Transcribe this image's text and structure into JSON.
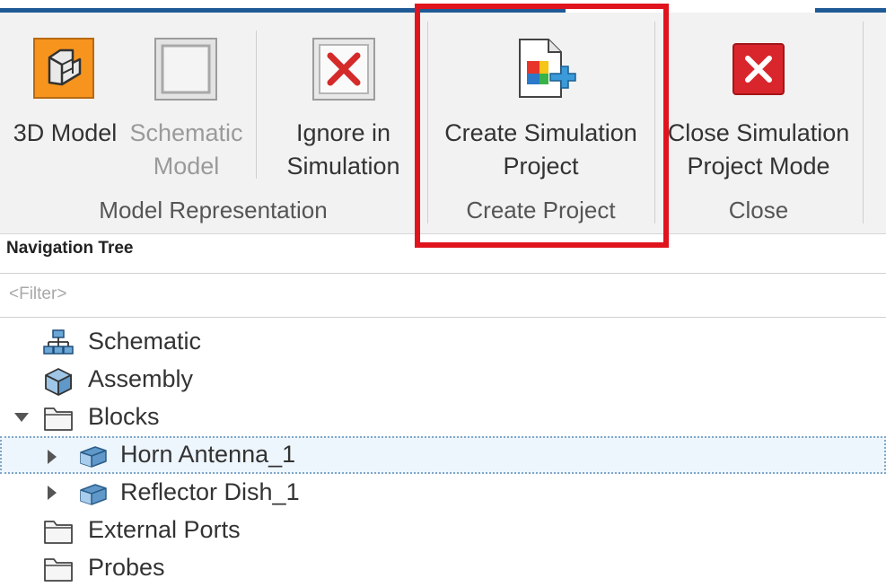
{
  "ribbon": {
    "buttons": {
      "model_3d": "3D Model",
      "schematic_line1": "Schematic",
      "schematic_line2": "Model",
      "ignore_line1": "Ignore in",
      "ignore_line2": "Simulation",
      "create_line1": "Create Simulation",
      "create_line2": "Project",
      "close_line1": "Close Simulation",
      "close_line2": "Project Mode"
    },
    "groups": {
      "model_representation": "Model Representation",
      "create_project": "Create Project",
      "close": "Close"
    }
  },
  "navigation_tree": {
    "title": "Navigation Tree",
    "filter_placeholder": "<Filter>",
    "items": [
      {
        "label": "Schematic",
        "icon": "schematic-icon"
      },
      {
        "label": "Assembly",
        "icon": "assembly-icon"
      },
      {
        "label": "Blocks",
        "icon": "folder-icon",
        "expanded": true
      },
      {
        "label": "Horn Antenna_1",
        "icon": "block-icon",
        "selected": true
      },
      {
        "label": "Reflector Dish_1",
        "icon": "block-icon"
      },
      {
        "label": "External Ports",
        "icon": "folder-icon"
      },
      {
        "label": "Probes",
        "icon": "folder-icon"
      }
    ]
  },
  "colors": {
    "accent_blue": "#1f5a96",
    "highlight_red": "#e0141d",
    "model_orange": "#f7941d",
    "close_red": "#d9262c"
  }
}
